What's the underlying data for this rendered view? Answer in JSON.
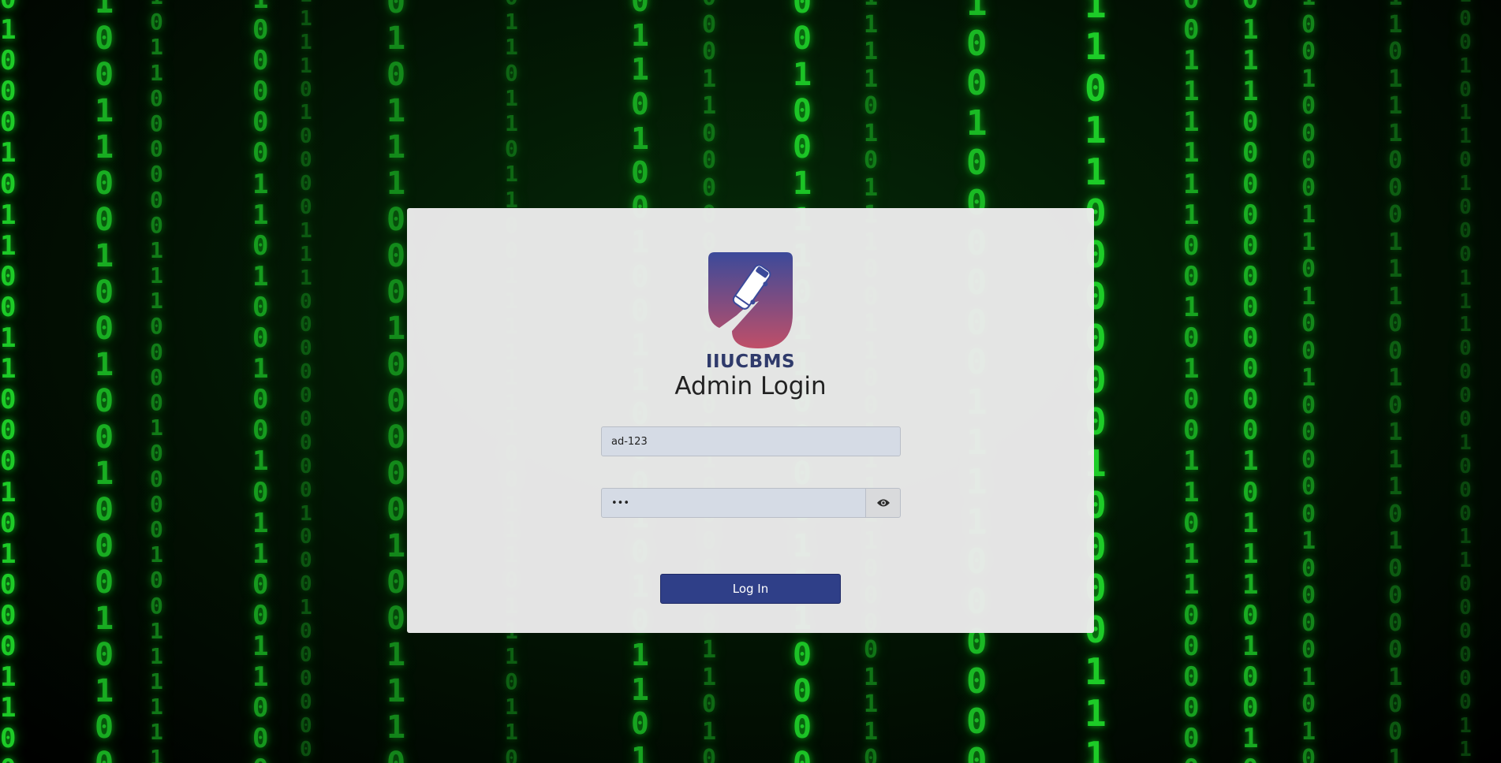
{
  "brand": {
    "name": "IIUCBMS",
    "logo_icon": "bus-logo-icon",
    "logo_colors": [
      "#3b4a9a",
      "#c04f68"
    ]
  },
  "login": {
    "title": "Admin Login",
    "username_value": "ad-123",
    "password_value": "•••",
    "show_password_icon": "eye-icon",
    "submit_label": "Log In"
  },
  "background": {
    "theme": "matrix-binary-rain",
    "accent": "#1fd62a"
  }
}
